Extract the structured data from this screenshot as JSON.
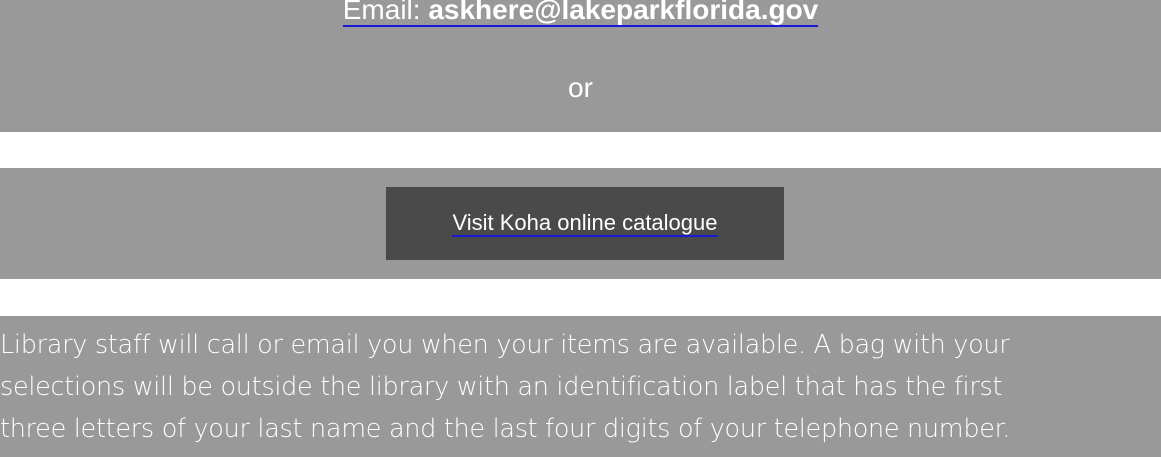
{
  "contact": {
    "email_prefix": "Email: ",
    "email_address": "askhere@lakeparkflorida.gov",
    "or_text": "or"
  },
  "catalogue": {
    "button_label": "Visit Koha online catalogue"
  },
  "pickup_info": {
    "lines": [
      "Library staff will call or email you when your items are available. A bag with your",
      "selections will be outside the library with an identification label that has the first",
      "three letters of your last name and the last four digits of your telephone number."
    ]
  },
  "colors": {
    "band_background": "#999999",
    "button_background": "#4a4a4a",
    "link_underline": "#1a1ad6",
    "text": "#ffffff"
  }
}
